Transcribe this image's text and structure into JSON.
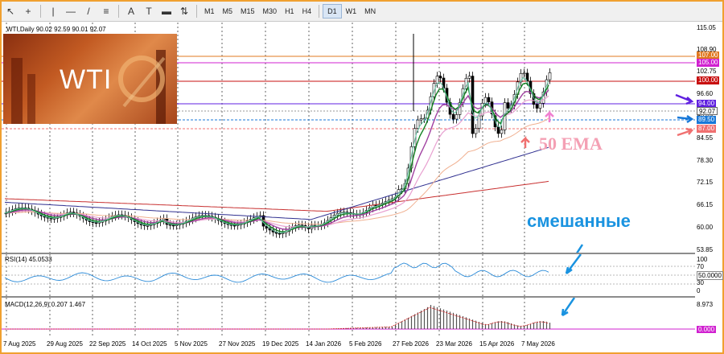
{
  "toolbar": {
    "tools": [
      {
        "name": "cursor-tool",
        "glyph": "↖"
      },
      {
        "name": "crosshair-tool",
        "glyph": "+"
      },
      {
        "name": "vertical-line-tool",
        "glyph": "|"
      },
      {
        "name": "horizontal-line-tool",
        "glyph": "—"
      },
      {
        "name": "trendline-tool",
        "glyph": "/"
      },
      {
        "name": "channel-tool",
        "glyph": "≡"
      },
      {
        "name": "text-tool",
        "glyph": "A"
      },
      {
        "name": "label-tool",
        "glyph": "T"
      },
      {
        "name": "rectangle-tool",
        "glyph": "▬"
      },
      {
        "name": "arrows-tool",
        "glyph": "⇅"
      }
    ],
    "timeframes": [
      "M1",
      "M5",
      "M15",
      "M30",
      "H1",
      "H4",
      "D1",
      "W1",
      "MN"
    ],
    "active_timeframe": "D1"
  },
  "chart": {
    "title": "WTI,Daily  90.02 92.59 90.01 92.07",
    "thumbnail_text": "WTI",
    "annotation_ema": "50 EMA",
    "annotation_mixed": "смешанные"
  },
  "price_scale": [
    "115.05",
    "108.90",
    "102.75",
    "96.60",
    "90.45",
    "84.55",
    "78.30",
    "72.15",
    "66.15",
    "60.00",
    "53.85"
  ],
  "price_labels": [
    {
      "text": "107.00",
      "color": "#e07820"
    },
    {
      "text": "105.00",
      "color": "#d020d0"
    },
    {
      "text": "100.00",
      "color": "#c81010"
    },
    {
      "text": "94.00",
      "color": "#6020e0"
    },
    {
      "text": "92.07",
      "color": "#ffffff"
    },
    {
      "text": "89.50",
      "color": "#1878d8"
    },
    {
      "text": "87.00",
      "color": "#f07070"
    }
  ],
  "rsi": {
    "title": "RSI(14) 45.0533",
    "scale": [
      "100",
      "70",
      "50.0000",
      "30",
      "0"
    ]
  },
  "macd": {
    "title": "MACD(12,26,9) 0.207 1.467",
    "scale": [
      "8.973",
      "0.000"
    ]
  },
  "dates": [
    "7 Aug 2025",
    "29 Aug 2025",
    "22 Sep 2025",
    "14 Oct 2025",
    "5 Nov 2025",
    "27 Nov 2025",
    "19 Dec 2025",
    "14 Jan 2026",
    "5 Feb 2026",
    "27 Feb 2026",
    "23 Mar 2026",
    "15 Apr 2026",
    "7 May 2026"
  ]
}
